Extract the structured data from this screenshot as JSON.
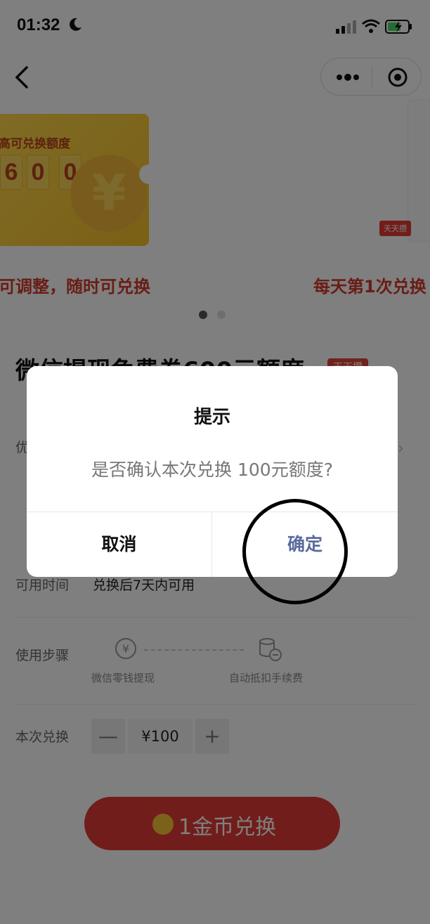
{
  "status_bar": {
    "time": "01:32"
  },
  "banner": {
    "card_title": "高可兑换额度",
    "digits": [
      "6",
      "0",
      "0"
    ],
    "coin_symbol": "¥",
    "mini_tag": "天天攒",
    "slogan_left": "可调整，随时可兑换",
    "slogan_right": "每天第1次兑换"
  },
  "product": {
    "title": "微信提现免费券600元额度",
    "tag": "天天攒",
    "row1_label": "优",
    "time_label": "可用时间",
    "time_value": "兑换后7天内可用",
    "steps_label": "使用步骤",
    "step1": "微信零钱提现",
    "step2": "自动抵扣手续费",
    "exchange_label": "本次兑换",
    "stepper": {
      "minus": "—",
      "value": "¥100",
      "plus": "+"
    },
    "cta_label": "1金币兑换"
  },
  "dialog": {
    "title": "提示",
    "message": "是否确认本次兑换 100元额度?",
    "cancel": "取消",
    "confirm": "确定"
  },
  "colors": {
    "accent": "#e23a36",
    "confirm_text": "#5a6b9c",
    "overlay": "rgba(0,0,0,0.5)"
  }
}
